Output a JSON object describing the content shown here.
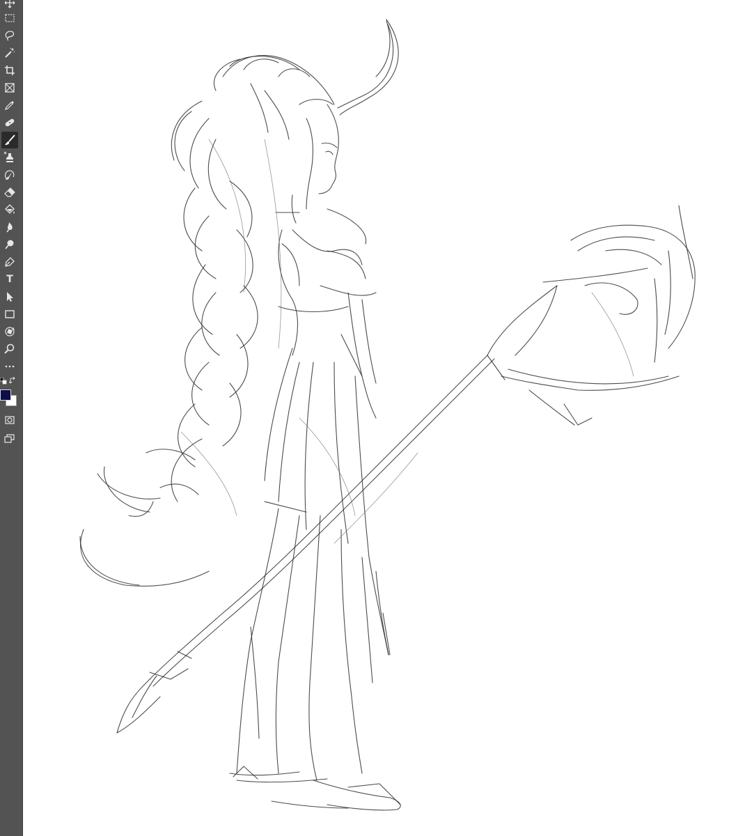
{
  "toolbar": {
    "tools": [
      {
        "id": "move",
        "icon": "move-icon",
        "active": false
      },
      {
        "id": "marquee",
        "icon": "marquee-icon",
        "active": false
      },
      {
        "id": "lasso",
        "icon": "lasso-icon",
        "active": false
      },
      {
        "id": "magic-wand",
        "icon": "magic-wand-icon",
        "active": false
      },
      {
        "id": "crop",
        "icon": "crop-icon",
        "active": false
      },
      {
        "id": "frame",
        "icon": "frame-icon",
        "active": false
      },
      {
        "id": "eyedropper",
        "icon": "eyedropper-icon",
        "active": false
      },
      {
        "id": "healing",
        "icon": "bandage-icon",
        "active": false
      },
      {
        "id": "brush",
        "icon": "brush-icon",
        "active": true
      },
      {
        "id": "clone-stamp",
        "icon": "stamp-icon",
        "active": false
      },
      {
        "id": "history-brush",
        "icon": "history-brush-icon",
        "active": false
      },
      {
        "id": "eraser",
        "icon": "eraser-icon",
        "active": false
      },
      {
        "id": "paint-bucket",
        "icon": "paint-bucket-icon",
        "active": false
      },
      {
        "id": "blur",
        "icon": "blur-icon",
        "active": false
      },
      {
        "id": "dodge",
        "icon": "dodge-icon",
        "active": false
      },
      {
        "id": "pen",
        "icon": "pen-icon",
        "active": false
      },
      {
        "id": "type",
        "icon": "type-icon",
        "active": false,
        "glyph": "T"
      },
      {
        "id": "path-selection",
        "icon": "arrow-cursor-icon",
        "active": false
      },
      {
        "id": "rectangle",
        "icon": "rectangle-icon",
        "active": false
      },
      {
        "id": "rotate-view",
        "icon": "rotate-view-icon",
        "active": false
      },
      {
        "id": "zoom",
        "icon": "zoom-icon",
        "active": false
      },
      {
        "id": "more",
        "icon": "ellipsis-icon",
        "active": false
      }
    ],
    "colors": {
      "foreground": "#0d0d4a",
      "background": "#ffffff"
    }
  }
}
